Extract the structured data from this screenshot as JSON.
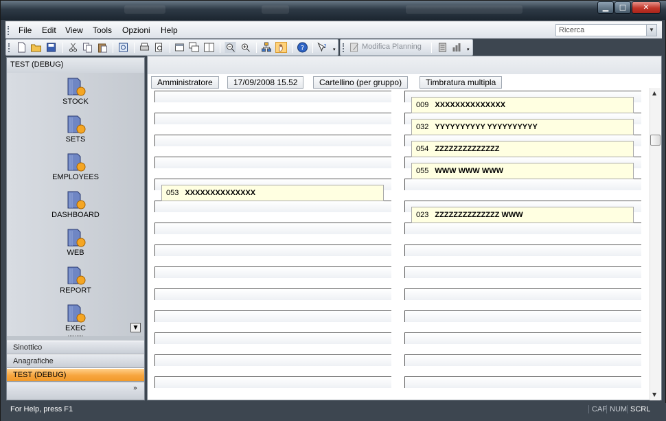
{
  "window": {
    "title_controls": {
      "minimize": "▁",
      "maximize": "□",
      "close": "✕"
    }
  },
  "menu": [
    "File",
    "Edit",
    "View",
    "Tools",
    "Opzioni",
    "Help"
  ],
  "search": {
    "placeholder": "Ricerca"
  },
  "toolbar2": {
    "modifica_label": "Modifica Planning"
  },
  "left_pane": {
    "header": "TEST (DEBUG)",
    "shortcuts": [
      "STOCK",
      "SETS",
      "EMPLOYEES",
      "DASHBOARD",
      "WEB",
      "REPORT",
      "EXEC"
    ],
    "nav_bars": [
      {
        "label": "Sinottico",
        "active": false
      },
      {
        "label": "Anagrafiche",
        "active": false
      },
      {
        "label": "TEST (DEBUG)",
        "active": true
      }
    ],
    "more_glyph": "»"
  },
  "main": {
    "tags": [
      "Amministratore",
      "17/09/2008 15.52",
      "Cartellino (per gruppo)",
      "Timbratura multipla"
    ],
    "left_cards": [
      {
        "code": "053",
        "name": "XXXXXXXXXXXXXX"
      }
    ],
    "right_cards": [
      {
        "code": "009",
        "name": "XXXXXXXXXXXXXX"
      },
      {
        "code": "032",
        "name": "YYYYYYYYYY YYYYYYYYYY"
      },
      {
        "code": "054",
        "name": "ZZZZZZZZZZZZZZ"
      },
      {
        "code": "055",
        "name": "WWW WWW WWW"
      },
      {
        "code": "023",
        "name": "ZZZZZZZZZZZZZZ WWW"
      }
    ]
  },
  "status": {
    "message": "For Help, press F1",
    "indicators": [
      {
        "label": "CAP",
        "on": false
      },
      {
        "label": "NUM",
        "on": false
      },
      {
        "label": "SCRL",
        "on": true
      }
    ]
  },
  "colors": {
    "accent_orange": "#f7a53e",
    "card_bg": "#ffffe1",
    "chrome_dark": "#3d4650"
  }
}
